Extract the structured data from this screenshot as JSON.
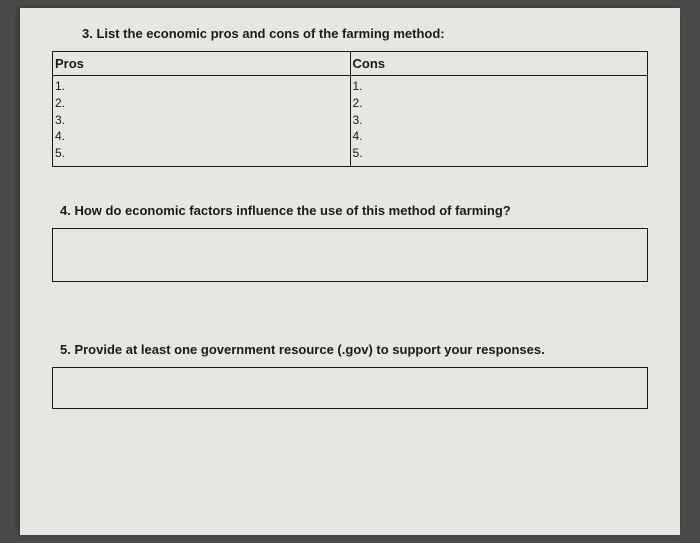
{
  "q3": {
    "prompt": "3. List the economic pros and cons of the farming method:",
    "headers": {
      "pros": "Pros",
      "cons": "Cons"
    },
    "nums": [
      "1.",
      "2.",
      "3.",
      "4.",
      "5."
    ]
  },
  "q4": {
    "prompt": "4. How do economic factors influence the use of this method of farming?"
  },
  "q5": {
    "prompt": "5. Provide at least one government resource (.gov) to support your responses."
  }
}
